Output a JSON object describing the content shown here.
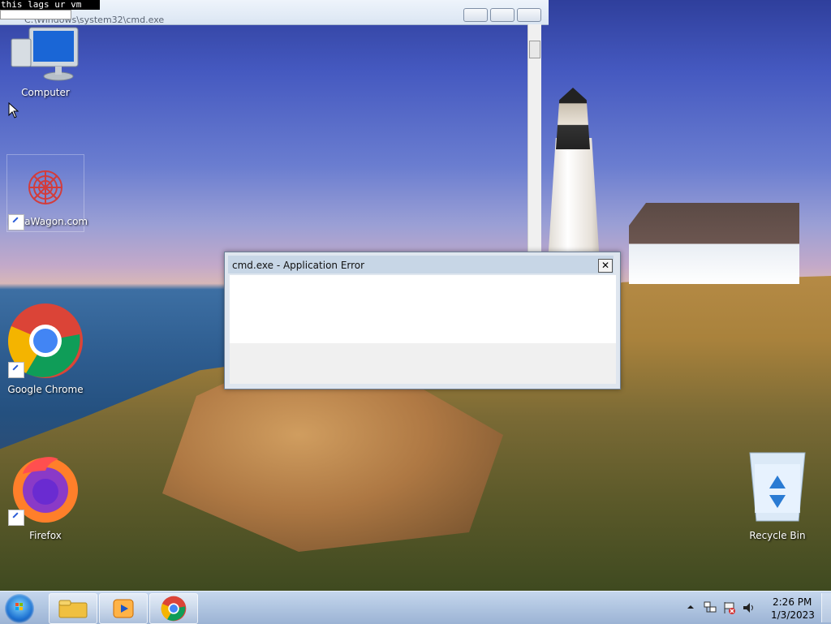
{
  "cmd_window": {
    "console_text": "this lags ur vm",
    "title": "C:\\Windows\\system32\\cmd.exe"
  },
  "desktop_icons": [
    {
      "label": "Computer",
      "icon": "computer-icon"
    },
    {
      "label": "DataWagon.com",
      "icon": "datawagon-icon"
    },
    {
      "label": "Google Chrome",
      "icon": "chrome-icon"
    },
    {
      "label": "Firefox",
      "icon": "firefox-icon"
    },
    {
      "label": "Recycle Bin",
      "icon": "recycle-bin-icon"
    }
  ],
  "dialog": {
    "title": "cmd.exe - Application Error",
    "close": "✕"
  },
  "taskbar": {
    "pinned": [
      "explorer-icon",
      "media-player-icon",
      "chrome-icon"
    ]
  },
  "tray": {
    "time": "2:26 PM",
    "date": "1/3/2023"
  }
}
